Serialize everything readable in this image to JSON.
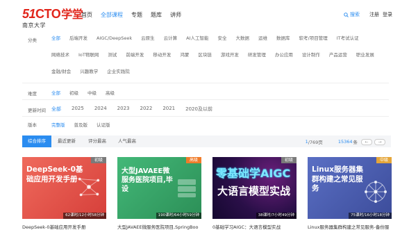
{
  "header": {
    "logo_num": "51",
    "logo_cto": "CTO",
    "logo_cn": "学堂",
    "logo_sub": "南京大学",
    "nav": [
      "首页",
      "全部课程",
      "专题",
      "题库",
      "讲师"
    ],
    "search_label": "搜索",
    "register_label": "注册",
    "login_label": "登录"
  },
  "filters": {
    "category": {
      "label": "分类",
      "options": [
        "全部",
        "后端开发",
        "AIGC/DeepSeek",
        "云原生",
        "云计算",
        "AI人工智能",
        "安全",
        "大数据",
        "运维",
        "数据库",
        "软考/项目管理",
        "IT考试认证",
        "网络技术",
        "IoT物联网",
        "测试",
        "前端开发",
        "移动开发",
        "鸿蒙",
        "区块链",
        "游戏开发",
        "研发管理",
        "办公应用",
        "设计制作",
        "产品运营",
        "职业发展",
        "金融/财会",
        "兴趣教学",
        "企业实践院"
      ]
    },
    "difficulty": {
      "label": "难度",
      "options": [
        "全部",
        "初级",
        "中级",
        "高级"
      ]
    },
    "time": {
      "label": "更新时间",
      "options": [
        "全部",
        "2025",
        "2024",
        "2023",
        "2022",
        "2021",
        "2020及以前"
      ]
    },
    "version": {
      "label": "版本",
      "options": [
        "完整版",
        "普及版",
        "认证版"
      ]
    }
  },
  "sortbar": {
    "tabs": [
      "综合排序",
      "最近更新",
      "评分最高",
      "人气最高"
    ],
    "page_current": "1",
    "page_total": "/769页",
    "total_count": "15364",
    "total_unit": "条",
    "prev_icon": "←",
    "next_icon": "→"
  },
  "courses": [
    {
      "thumb_text": "DeepSeek-0基础应用开发手册",
      "badge": "初级",
      "duration": "62课时/12小时58分钟",
      "title": "DeepSeek-0基础应用开发手册",
      "bg": "#e2534a",
      "badge_color": "#7a7a7a"
    },
    {
      "thumb_text": "大型JAVAEE微服务医院项目,毕设",
      "badge": "高级",
      "duration": "190课时/64小时59分钟",
      "title": "大型JAVAEE微服务医院项目,SpringBoo",
      "bg": "#3aa46a",
      "badge_color": "#f07c2a"
    },
    {
      "thumb_text_1": "零基础学AIGC",
      "thumb_text_2": "大语言模型实战",
      "badge": "初级",
      "duration": "38课时/7小时49分钟",
      "title": "0基础学习AIGC：大语言模型实战",
      "bg": "#1a0a3a",
      "badge_color": "#7a7a7a"
    },
    {
      "thumb_text": "Linux服务器集群构建之常见服务",
      "badge": "中级",
      "duration": "75课时/16小时18分钟",
      "title": "Linux服务器集群构建之常见服务-备份服",
      "bg": "#4b5fb0",
      "badge_color": "#e5a63a"
    }
  ]
}
